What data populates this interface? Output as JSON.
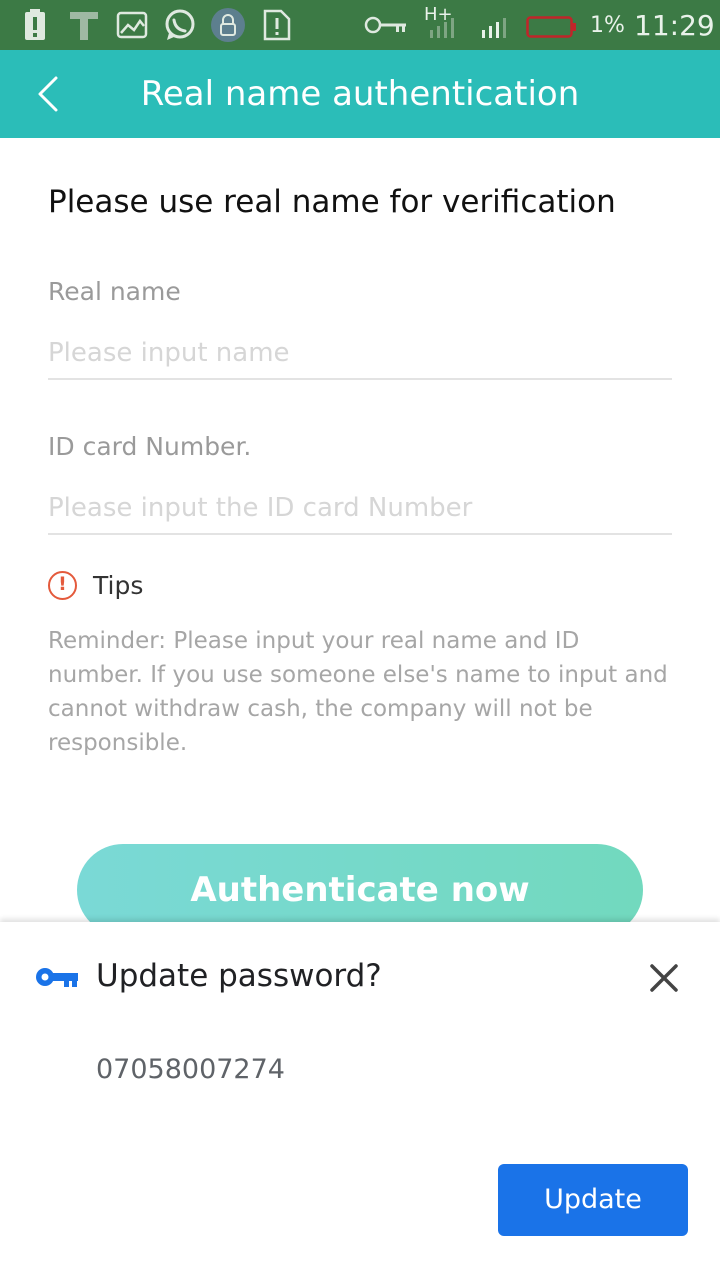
{
  "status_bar": {
    "network": "H+",
    "battery_percent": "1%",
    "time": "11:29"
  },
  "app_bar": {
    "title": "Real name authentication"
  },
  "form": {
    "heading": "Please use real name for verification",
    "name_label": "Real name",
    "name_placeholder": "Please input name",
    "name_value": "",
    "id_label": "ID card Number.",
    "id_placeholder": "Please input the ID card Number",
    "id_value": "",
    "tips_label": "Tips",
    "reminder": "Reminder: Please input your real name and ID number. If you use someone else's name to input and cannot withdraw cash, the company will not be responsible.",
    "submit_label": "Authenticate now"
  },
  "password_sheet": {
    "title": "Update password?",
    "account": "07058007274",
    "update_label": "Update"
  },
  "colors": {
    "status_bar": "#3c7a45",
    "app_bar": "#2bbdb8",
    "button_gradient_start": "#7ad9d6",
    "button_gradient_end": "#72d9be",
    "tips_accent": "#e45a3c",
    "update_button": "#1a73e8",
    "key_icon": "#1a73e8"
  },
  "icons": {
    "status": [
      "battery-alert-icon",
      "t-app-icon",
      "image-icon",
      "whatsapp-icon",
      "lock-icon",
      "file-alert-icon",
      "vpn-key-icon",
      "signal-icon",
      "battery-low-icon"
    ],
    "back": "chevron-left-icon",
    "tips": "exclamation-circle-icon",
    "sheet_key": "key-icon",
    "sheet_close": "close-icon"
  }
}
